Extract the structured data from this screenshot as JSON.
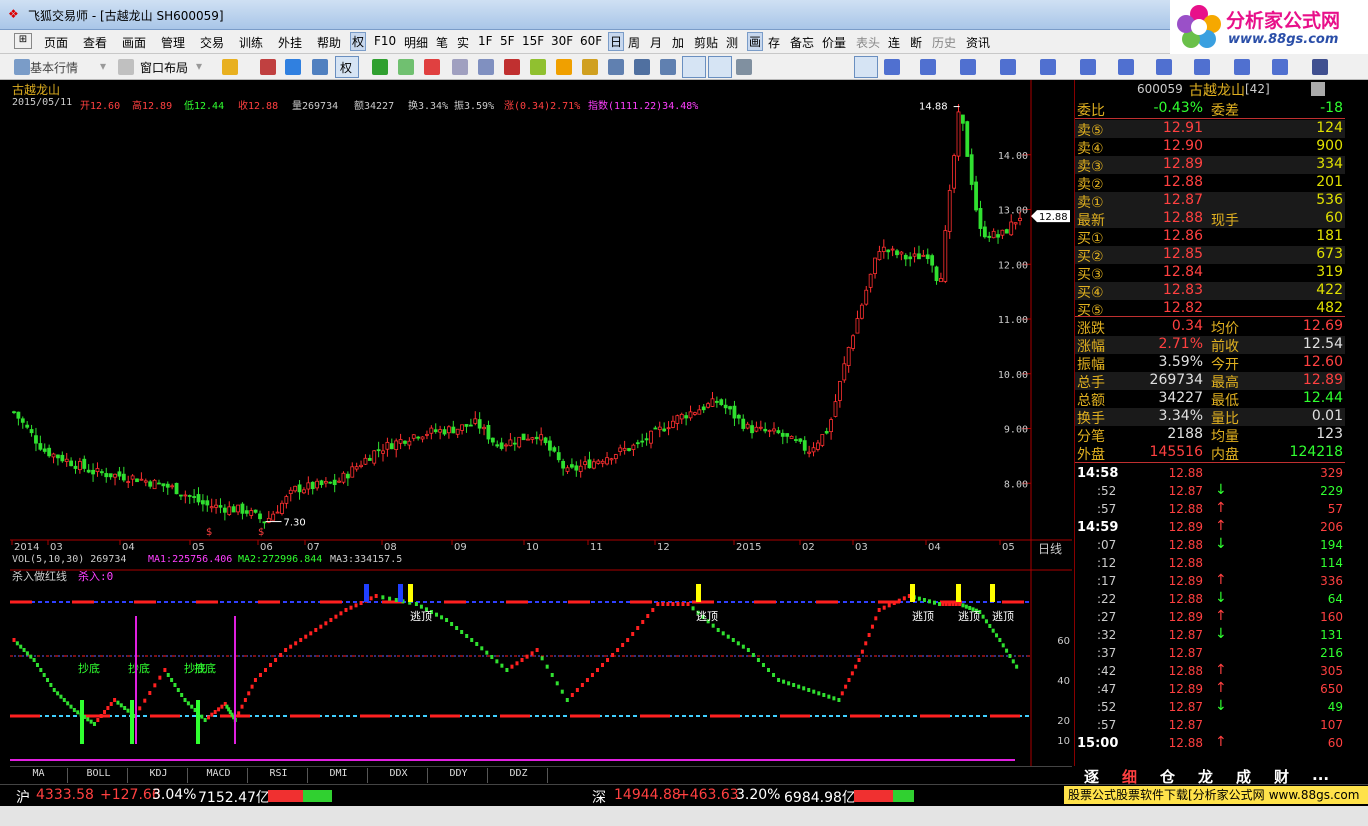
{
  "window": {
    "title": "飞狐交易师 - [古越龙山 SH600059]"
  },
  "logo": {
    "line1": "分析家公式网",
    "line2": "www.88gs.com"
  },
  "menu": [
    "页面",
    "查看",
    "画面",
    "管理",
    "交易",
    "训练",
    "外挂",
    "帮助",
    "权",
    "F10",
    "明细",
    "笔",
    "实",
    "1F",
    "5F",
    "15F",
    "30F",
    "60F",
    "日",
    "周",
    "月",
    "加",
    "剪贴",
    "测",
    "画",
    "存",
    "备忘",
    "价量",
    "表头",
    "连",
    "断",
    "历史",
    "资讯"
  ],
  "toolbar": {
    "label1": "基本行情",
    "label2": "窗口布局",
    "label3": "权"
  },
  "chart": {
    "stock_name": "古越龙山",
    "date": "2015/05/11",
    "open": "开12.60",
    "high": "高12.89",
    "low": "低12.44",
    "close": "收12.88",
    "vol": "量269734",
    "amount": "额34227",
    "turnover": "换3.34%",
    "amplitude": "振3.59%",
    "change": "涨(0.34)2.71%",
    "index": "指数(1111.22)34.48%",
    "price_labels": [
      "14.00",
      "13.00",
      "12.00",
      "11.00",
      "10.00",
      "9.00",
      "8.00"
    ],
    "high_mark": "14.88",
    "low_mark": "7.30",
    "current_price_tag": "12.88",
    "x_labels": [
      "2014",
      "03",
      "04",
      "05",
      "06",
      "07",
      "08",
      "09",
      "10",
      "11",
      "12",
      "2015",
      "02",
      "03",
      "04",
      "05"
    ],
    "x_unit": "日线",
    "vol_line": "VOL(5,10,30)  269734",
    "ma1": "MA1:225756.406",
    "ma2": "MA2:272996.844",
    "ma3": "MA3:334157.5",
    "ind_name": "杀入做红线",
    "ind_value": "杀入:0",
    "ind_y_labels": [
      "60",
      "40",
      "20",
      "10"
    ],
    "annot_bottom": "抄底",
    "annot_top": "逃顶"
  },
  "chart_data": {
    "type": "candlestick",
    "title": "古越龙山",
    "x_labels": [
      "2014",
      "03",
      "04",
      "05",
      "06",
      "07",
      "08",
      "09",
      "10",
      "11",
      "12",
      "2015",
      "02",
      "03",
      "04",
      "05"
    ],
    "ylim": [
      7.0,
      15.0
    ],
    "price_path": [
      [
        0,
        9.3
      ],
      [
        0.03,
        8.6
      ],
      [
        0.08,
        8.2
      ],
      [
        0.12,
        8.1
      ],
      [
        0.16,
        7.9
      ],
      [
        0.19,
        7.6
      ],
      [
        0.23,
        7.5
      ],
      [
        0.25,
        7.3
      ],
      [
        0.28,
        7.9
      ],
      [
        0.32,
        8.0
      ],
      [
        0.36,
        8.6
      ],
      [
        0.4,
        8.9
      ],
      [
        0.44,
        9.0
      ],
      [
        0.46,
        9.1
      ],
      [
        0.48,
        8.7
      ],
      [
        0.52,
        8.9
      ],
      [
        0.55,
        8.2
      ],
      [
        0.59,
        8.5
      ],
      [
        0.62,
        8.7
      ],
      [
        0.66,
        9.2
      ],
      [
        0.7,
        9.5
      ],
      [
        0.73,
        9.0
      ],
      [
        0.76,
        8.9
      ],
      [
        0.79,
        8.6
      ],
      [
        0.81,
        9.0
      ],
      [
        0.83,
        10.5
      ],
      [
        0.86,
        12.3
      ],
      [
        0.89,
        12.1
      ],
      [
        0.91,
        12.2
      ],
      [
        0.92,
        11.6
      ],
      [
        0.94,
        14.88
      ],
      [
        0.96,
        12.6
      ],
      [
        0.98,
        12.5
      ],
      [
        1.0,
        12.88
      ]
    ],
    "last": {
      "open": 12.6,
      "high": 12.89,
      "low": 12.44,
      "close": 12.88,
      "volume": 269734,
      "amount": 34227
    }
  },
  "quote": {
    "header_code": "600059",
    "header_name": "古越龙山",
    "header_num": "[42]",
    "weibi_label": "委比",
    "weibi_value": "-0.43%",
    "weicha_label": "委差",
    "weicha_value": "-18",
    "sells": [
      {
        "label": "卖⑤",
        "price": "12.91",
        "vol": "124"
      },
      {
        "label": "卖④",
        "price": "12.90",
        "vol": "900"
      },
      {
        "label": "卖③",
        "price": "12.89",
        "vol": "334"
      },
      {
        "label": "卖②",
        "price": "12.88",
        "vol": "201"
      },
      {
        "label": "卖①",
        "price": "12.87",
        "vol": "536"
      }
    ],
    "latest_label": "最新",
    "latest_price": "12.88",
    "xianshou_label": "现手",
    "xianshou_value": "60",
    "buys": [
      {
        "label": "买①",
        "price": "12.86",
        "vol": "181"
      },
      {
        "label": "买②",
        "price": "12.85",
        "vol": "673"
      },
      {
        "label": "买③",
        "price": "12.84",
        "vol": "319"
      },
      {
        "label": "买④",
        "price": "12.83",
        "vol": "422"
      },
      {
        "label": "买⑤",
        "price": "12.82",
        "vol": "482"
      }
    ],
    "stats": [
      {
        "l1": "涨跌",
        "v1": "0.34",
        "c1": "#ff4040",
        "l2": "均价",
        "v2": "12.69",
        "c2": "#ff4040"
      },
      {
        "l1": "涨幅",
        "v1": "2.71%",
        "c1": "#ff4040",
        "l2": "前收",
        "v2": "12.54",
        "c2": "#e0e0e0"
      },
      {
        "l1": "振幅",
        "v1": "3.59%",
        "c1": "#e0e0e0",
        "l2": "今开",
        "v2": "12.60",
        "c2": "#ff4040"
      },
      {
        "l1": "总手",
        "v1": "269734",
        "c1": "#e0e0e0",
        "l2": "最高",
        "v2": "12.89",
        "c2": "#ff4040"
      },
      {
        "l1": "总额",
        "v1": "34227",
        "c1": "#e0e0e0",
        "l2": "最低",
        "v2": "12.44",
        "c2": "#30ff30"
      },
      {
        "l1": "换手",
        "v1": "3.34%",
        "c1": "#e0e0e0",
        "l2": "量比",
        "v2": "0.01",
        "c2": "#e0e0e0"
      },
      {
        "l1": "分笔",
        "v1": "2188",
        "c1": "#e0e0e0",
        "l2": "均量",
        "v2": "123",
        "c2": "#e0e0e0"
      }
    ],
    "waipan_label": "外盘",
    "waipan_value": "145516",
    "neipan_label": "内盘",
    "neipan_value": "124218",
    "ticks": [
      {
        "t": "14:58",
        "p": "12.88",
        "a": "",
        "v": "329",
        "big": true,
        "pc": "#ff4040",
        "vc": "#ff4040"
      },
      {
        "t": ":52",
        "p": "12.87",
        "a": "↓",
        "v": "229",
        "pc": "#ff4040",
        "vc": "#30ff30"
      },
      {
        "t": ":57",
        "p": "12.88",
        "a": "↑",
        "v": "57",
        "pc": "#ff4040",
        "vc": "#ff4040"
      },
      {
        "t": "14:59",
        "p": "12.89",
        "a": "↑",
        "v": "206",
        "big": true,
        "pc": "#ff4040",
        "vc": "#ff4040"
      },
      {
        "t": ":07",
        "p": "12.88",
        "a": "↓",
        "v": "194",
        "pc": "#ff4040",
        "vc": "#30ff30"
      },
      {
        "t": ":12",
        "p": "12.88",
        "a": "",
        "v": "114",
        "pc": "#ff4040",
        "vc": "#30ff30"
      },
      {
        "t": ":17",
        "p": "12.89",
        "a": "↑",
        "v": "336",
        "pc": "#ff4040",
        "vc": "#ff4040"
      },
      {
        "t": ":22",
        "p": "12.88",
        "a": "↓",
        "v": "64",
        "pc": "#ff4040",
        "vc": "#30ff30"
      },
      {
        "t": ":27",
        "p": "12.89",
        "a": "↑",
        "v": "160",
        "pc": "#ff4040",
        "vc": "#ff4040"
      },
      {
        "t": ":32",
        "p": "12.87",
        "a": "↓",
        "v": "131",
        "pc": "#ff4040",
        "vc": "#30ff30"
      },
      {
        "t": ":37",
        "p": "12.87",
        "a": "",
        "v": "216",
        "pc": "#ff4040",
        "vc": "#30ff30"
      },
      {
        "t": ":42",
        "p": "12.88",
        "a": "↑",
        "v": "305",
        "pc": "#ff4040",
        "vc": "#ff4040"
      },
      {
        "t": ":47",
        "p": "12.89",
        "a": "↑",
        "v": "650",
        "pc": "#ff4040",
        "vc": "#ff4040"
      },
      {
        "t": ":52",
        "p": "12.87",
        "a": "↓",
        "v": "49",
        "pc": "#ff4040",
        "vc": "#30ff30"
      },
      {
        "t": ":57",
        "p": "12.87",
        "a": "",
        "v": "107",
        "pc": "#ff4040",
        "vc": "#ff4040"
      },
      {
        "t": "15:00",
        "p": "12.88",
        "a": "↑",
        "v": "60",
        "big": true,
        "pc": "#ff4040",
        "vc": "#ff4040"
      }
    ]
  },
  "bottom_tabs": [
    "MA",
    "BOLL",
    "KDJ",
    "MACD",
    "RSI",
    "DMI",
    "DDX",
    "DDY",
    "DDZ"
  ],
  "right_tabs": [
    "逐",
    "细",
    "仓",
    "龙",
    "成",
    "财",
    "..."
  ],
  "status": {
    "sh_label": "沪",
    "sh_index": "4333.58",
    "sh_chg": "+127.66",
    "sh_pct": "3.04%",
    "sh_amt": "7152.47亿",
    "sz_label": "深",
    "sz_index": "14944.88",
    "sz_chg": "+463.63",
    "sz_pct": "3.20%",
    "sz_amt": "6984.98亿"
  },
  "ad": {
    "text": "股票公式股票软件下载[分析家公式网",
    "url": "www.88gs.com"
  }
}
